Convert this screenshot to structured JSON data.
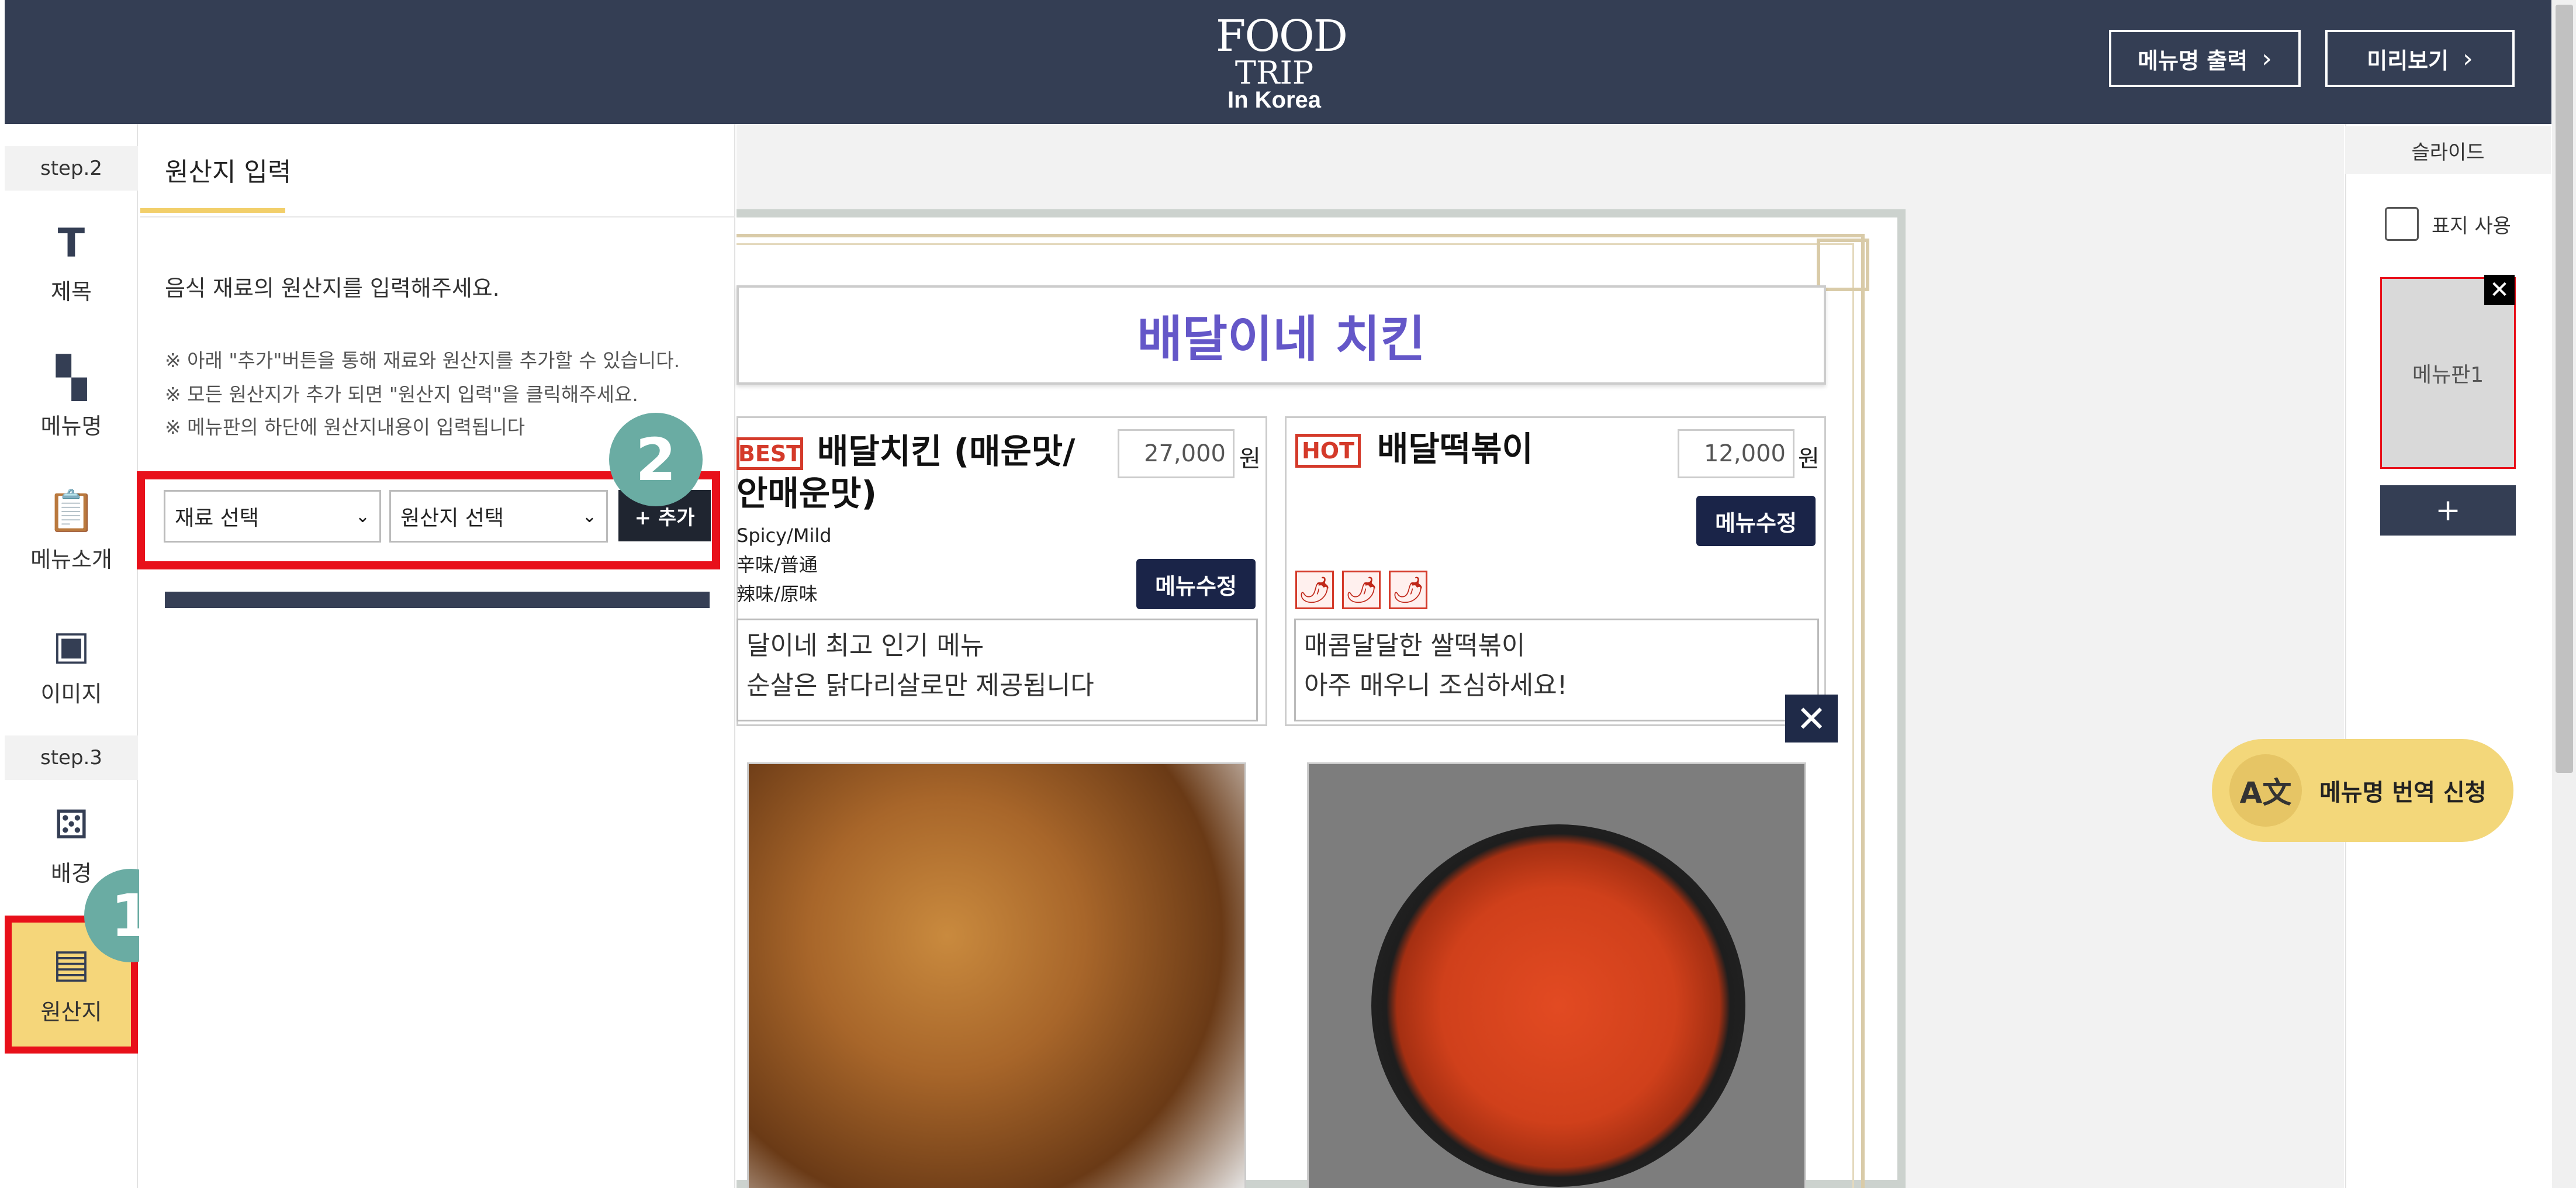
{
  "header": {
    "logo_line1": "FOOD",
    "logo_line2": "TRIP",
    "logo_line3": "In Korea",
    "print_menu_label": "메뉴명 출력",
    "preview_label": "미리보기",
    "chevron": "›"
  },
  "nav": {
    "step2": "step.2",
    "step3": "step.3",
    "items": [
      {
        "label": "제목",
        "icon": "T"
      },
      {
        "label": "메뉴명",
        "icon": "▚"
      },
      {
        "label": "메뉴소개",
        "icon": "📋"
      },
      {
        "label": "이미지",
        "icon": "▣"
      },
      {
        "label": "배경",
        "icon": "⚄"
      },
      {
        "label": "원산지",
        "icon": "▤"
      }
    ]
  },
  "badges": {
    "one": "1",
    "two": "2"
  },
  "panel": {
    "tab": "원산지 입력",
    "description": "음식 재료의 원산지를 입력해주세요.",
    "notes": [
      "※ 아래 \"추가\"버튼을 통해 재료와 원산지를 추가할 수 있습니다.",
      "※ 모든 원산지가 추가 되면 \"원산지 입력\"을 클릭해주세요.",
      "※ 메뉴판의 하단에 원산지내용이 입력됩니다"
    ],
    "ingredient_select": "재료 선택",
    "origin_select": "원산지 선택",
    "add_button": "+ 추가",
    "caret": "⌄"
  },
  "board": {
    "title": "배달이네 치킨",
    "items": [
      {
        "tag": "BEST",
        "name_line1": "배달치킨 (매운맛/",
        "name_line2": "안매운맛)",
        "price": "27,000",
        "currency": "원",
        "spice_en": "Spicy/Mild",
        "spice_cn": "辛味/普通",
        "spice_jp": "辣味/原味",
        "edit": "메뉴수정",
        "desc_line1": "달이네 최고 인기 메뉴",
        "desc_line2": "순살은 닭다리살로만 제공됩니다"
      },
      {
        "tag": "HOT",
        "name_line1": "배달떡볶이",
        "price": "12,000",
        "currency": "원",
        "edit": "메뉴수정",
        "pepper_icon": "🌶",
        "desc_line1": "매콤달달한 쌀떡볶이",
        "desc_line2": "아주 매우니 조심하세요!"
      }
    ],
    "close": "✕"
  },
  "slides": {
    "header": "슬라이드",
    "cover_label": "표지 사용",
    "thumb_label": "메뉴판1",
    "thumb_close": "✕",
    "add": "+"
  },
  "translate": {
    "label": "메뉴명 번역 신청",
    "icon": "A文"
  },
  "colors": {
    "header_bg": "#343e54",
    "highlight_red": "#e8101a",
    "badge_teal": "#6aaca3",
    "accent_yellow": "#f3d77a",
    "title_purple": "#6457c8"
  }
}
